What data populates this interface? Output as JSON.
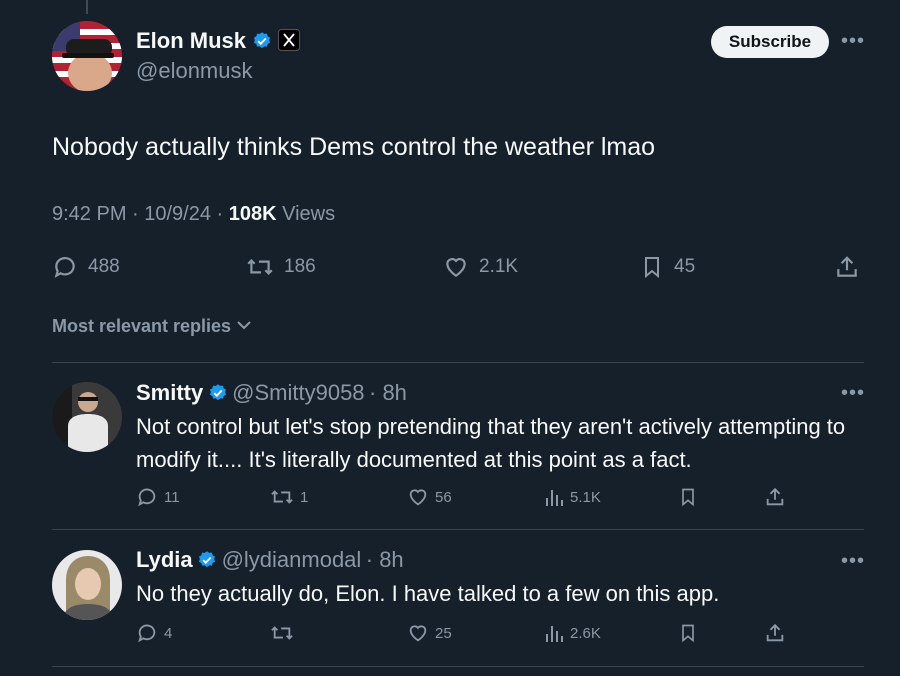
{
  "tweet": {
    "author_name": "Elon Musk",
    "author_handle": "@elonmusk",
    "subscribe_label": "Subscribe",
    "more_label": "•••",
    "text": "Nobody actually thinks Dems control the weather lmao",
    "time": "9:42 PM · 10/9/24 · ",
    "views_count": "108K",
    "views_label": " Views",
    "stats": {
      "replies": "488",
      "retweets": "186",
      "likes": "2.1K",
      "bookmarks": "45"
    }
  },
  "sort_label": "Most relevant replies",
  "replies": [
    {
      "name": "Smitty",
      "handle": "@Smitty9058",
      "time": "· 8h",
      "text": "Not control but let's stop pretending that they aren't actively attempting to modify it.... It's literally documented at this point as a fact.",
      "stats": {
        "replies": "11",
        "retweets": "1",
        "likes": "56",
        "views": "5.1K"
      }
    },
    {
      "name": "Lydia",
      "handle": "@lydianmodal",
      "time": "· 8h",
      "text": "No they actually do, Elon. I have talked to a few on this app.",
      "stats": {
        "replies": "4",
        "retweets": "",
        "likes": "25",
        "views": "2.6K"
      }
    }
  ],
  "colors": {
    "background": "#15202b",
    "text": "#f7f9f9",
    "secondary": "#8b98a5",
    "verified": "#1d9bf0"
  }
}
